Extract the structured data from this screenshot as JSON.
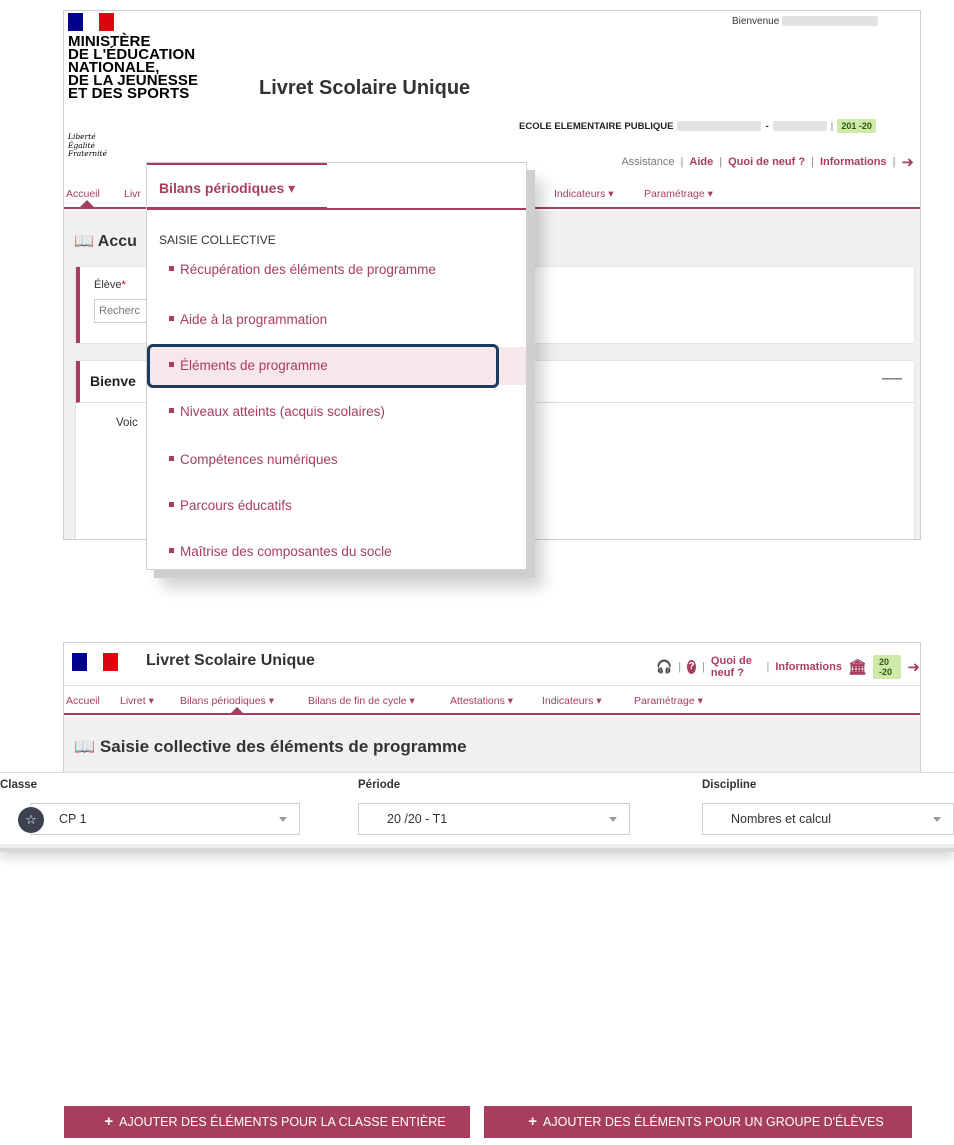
{
  "shot1": {
    "ministere_lines": [
      "MINISTÈRE",
      "DE L'ÉDUCATION",
      "NATIONALE,",
      "DE LA JEUNESSE",
      "ET DES SPORTS"
    ],
    "devise": [
      "Liberté",
      "Égalité",
      "Fraternité"
    ],
    "app_title": "Livret Scolaire Unique",
    "bienvenue": "Bienvenue",
    "school_label": "ECOLE ELEMENTAIRE PUBLIQUE",
    "school_dash": "-",
    "year": "201 -20",
    "util_links": {
      "assistance": "Assistance",
      "aide": "Aide",
      "quoi": "Quoi de neuf ?",
      "informations": "Informations"
    },
    "nav": {
      "accueil": "Accueil",
      "livret": "Livr",
      "indicateurs": "Indicateurs ▾",
      "parametrage": "Paramétrage ▾"
    },
    "page_title": "Accu",
    "eleve_label": "Élève",
    "eleve_required": "*",
    "eleve_placeholder": "Recherc",
    "bienvenue_card_title": "Bienve",
    "collapse": "—",
    "voic": "Voic",
    "dropdown": {
      "header": "Bilans périodiques ▾",
      "section": "SAISIE COLLECTIVE",
      "items": [
        "Récupération des éléments de programme",
        "Aide à la programmation",
        "Éléments de programme",
        "Niveaux atteints (acquis scolaires)",
        "Compétences numériques",
        "Parcours éducatifs",
        "Maîtrise des composantes du socle"
      ]
    }
  },
  "shot2": {
    "app_title": "Livret Scolaire Unique",
    "quoi": "Quoi de neuf ?",
    "informations": "Informations",
    "year": "20 -20",
    "nav": [
      "Accueil",
      "Livret ▾",
      "Bilans périodiques ▾",
      "Bilans de fin de cycle ▾",
      "Attestations ▾",
      "Indicateurs ▾",
      "Paramétrage ▾"
    ],
    "page_title": "Saisie collective des éléments de programme"
  },
  "filters": {
    "classe_label": "Classe",
    "classe_value": "CP 1",
    "periode_label": "Période",
    "periode_value": "20  /20   - T1",
    "discipline_label": "Discipline",
    "discipline_value": "Nombres et calcul"
  },
  "buttons": {
    "classe_entiere": "AJOUTER DES ÉLÉMENTS POUR LA CLASSE ENTIÈRE",
    "groupe": "AJOUTER DES ÉLÉMENTS POUR UN GROUPE D'ÉLÈVES"
  },
  "colors": {
    "accent": "#a83e5e",
    "highlight_frame": "#1f3a5f",
    "year_badge": "#cfe9a8"
  }
}
